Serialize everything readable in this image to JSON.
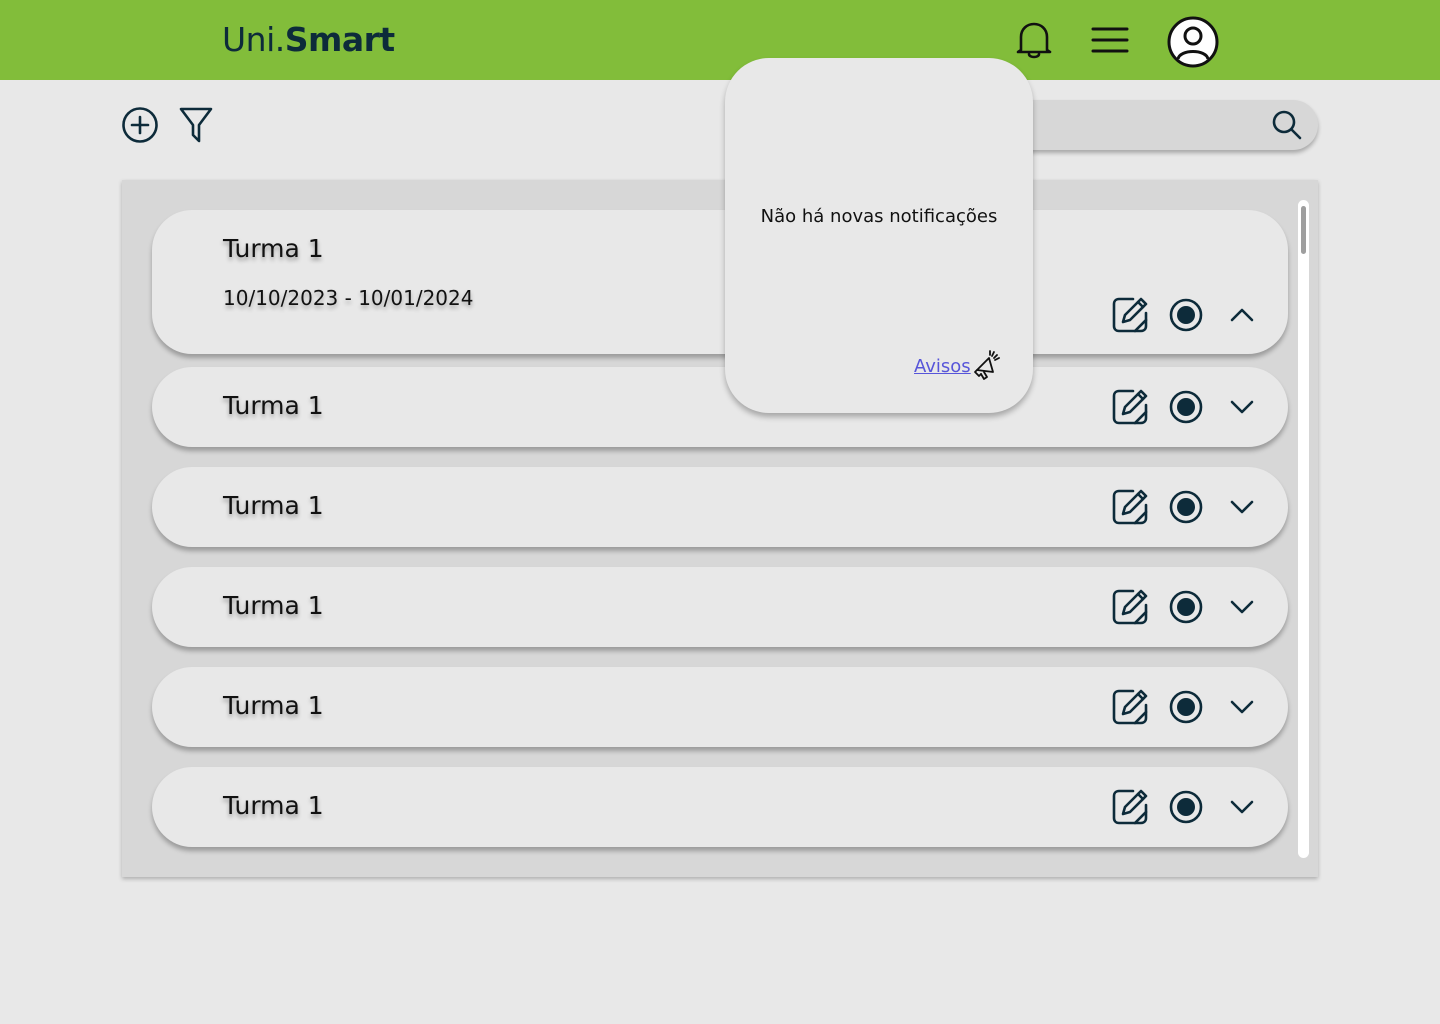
{
  "header": {
    "logo_part1": "Uni.",
    "logo_part2": "Smart",
    "icons": [
      "bell-icon",
      "hamburger-menu-icon",
      "user-avatar-icon"
    ]
  },
  "toolbar": {
    "icons": [
      "plus-circle-icon",
      "filter-icon"
    ],
    "search_placeholder": "",
    "search_icon": "search-icon"
  },
  "classes": [
    {
      "title": "Turma 1",
      "dates": "10/10/2023 - 10/01/2024",
      "expanded": true
    },
    {
      "title": "Turma 1",
      "expanded": false
    },
    {
      "title": "Turma 1",
      "expanded": false
    },
    {
      "title": "Turma 1",
      "expanded": false
    },
    {
      "title": "Turma 1",
      "expanded": false
    },
    {
      "title": "Turma 1",
      "expanded": false
    }
  ],
  "row_icons": [
    "edit-icon",
    "radio-selected-icon",
    "chevron-icon"
  ],
  "notifications": {
    "message": "Não há novas notificações",
    "link_label": "Avisos",
    "link_icon": "megaphone-icon"
  },
  "colors": {
    "header_bg": "#82bd3a",
    "logo_text": "#0d2b3a",
    "icon_stroke": "#0d2b3a",
    "background": "#e8e8e8",
    "panel_bg": "#d7d7d7",
    "link": "#5755d9"
  }
}
